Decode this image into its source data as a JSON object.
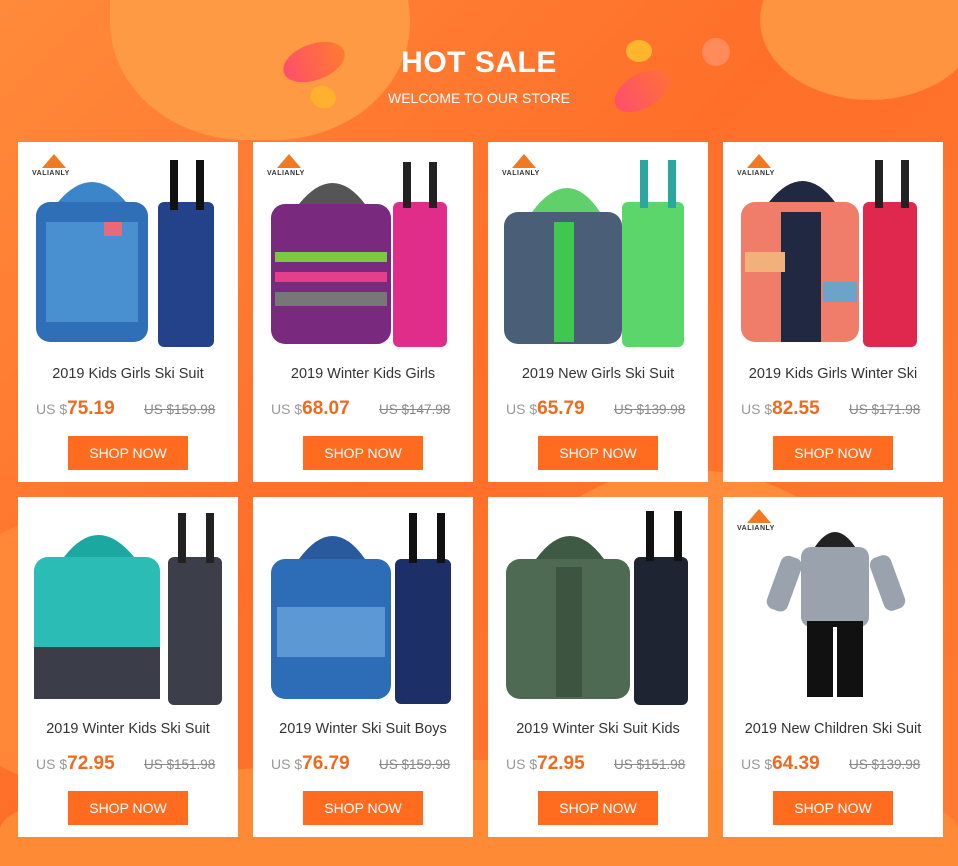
{
  "header": {
    "title": "HOT SALE",
    "subtitle": "WELCOME TO OUR STORE"
  },
  "brand": "VALIANLY",
  "colors": {
    "accent": "#ff6b1f",
    "price": "#ef6a1d",
    "background": "#ff7a2e"
  },
  "products": [
    {
      "name": "2019 Kids Girls Ski Suit",
      "currency": "US $",
      "price": "75.19",
      "old_price": "US $159.98",
      "button": "SHOP NOW"
    },
    {
      "name": "2019 Winter Kids Girls",
      "currency": "US $",
      "price": "68.07",
      "old_price": "US $147.98",
      "button": "SHOP NOW"
    },
    {
      "name": "2019 New Girls Ski Suit",
      "currency": "US $",
      "price": "65.79",
      "old_price": "US $139.98",
      "button": "SHOP NOW"
    },
    {
      "name": "2019 Kids Girls Winter Ski",
      "currency": "US $",
      "price": "82.55",
      "old_price": "US $171.98",
      "button": "SHOP NOW"
    },
    {
      "name": "2019 Winter Kids Ski Suit",
      "currency": "US $",
      "price": "72.95",
      "old_price": "US $151.98",
      "button": "SHOP NOW"
    },
    {
      "name": "2019 Winter Ski Suit Boys",
      "currency": "US $",
      "price": "76.79",
      "old_price": "US $159.98",
      "button": "SHOP NOW"
    },
    {
      "name": "2019 Winter Ski Suit Kids",
      "currency": "US $",
      "price": "72.95",
      "old_price": "US $151.98",
      "button": "SHOP NOW"
    },
    {
      "name": "2019 New Children Ski Suit",
      "currency": "US $",
      "price": "64.39",
      "old_price": "US $139.98",
      "button": "SHOP NOW"
    }
  ]
}
